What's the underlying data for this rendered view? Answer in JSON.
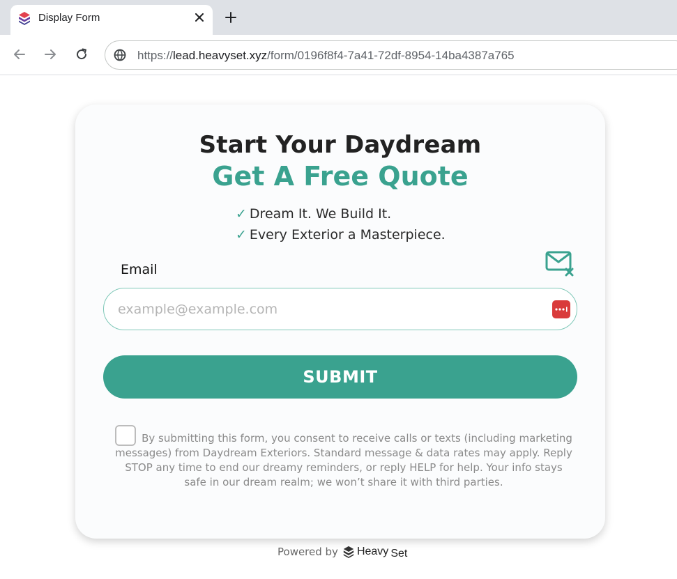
{
  "browser": {
    "tab": {
      "title": "Display Form"
    },
    "address": {
      "protocol": "https://",
      "host": "lead.heavyset.xyz",
      "path": "/form/0196f8f4-7a41-72df-8954-14ba4387a765"
    }
  },
  "form": {
    "heading": "Start Your Daydream",
    "subheading": "Get A Free Quote",
    "check_glyph": "✓",
    "bullets": [
      "Dream It. We Build It.",
      "Every Exterior a Masterpiece."
    ],
    "email_label": "Email",
    "email_placeholder": "example@example.com",
    "email_value": "",
    "submit_label": "SUBMIT",
    "consent_checked": false,
    "consent_text": "By submitting this form, you consent to receive calls or texts (including marketing messages) from Daydream Exteriors. Standard message & data rates may apply. Reply STOP any time to end our dreamy reminders, or reply HELP for help. Your info stays safe in our dream realm; we won’t share it with third parties."
  },
  "footer": {
    "powered_by": "Powered by",
    "brand_part1": "Heavy",
    "brand_part2": "Set"
  },
  "colors": {
    "accent": "#3aa28f",
    "heading": "#222222",
    "password_manager": "#d93b3b"
  },
  "icons": {
    "favicon": "heavyset-logo-icon",
    "mail_status": "mail-x-icon",
    "password_manager": "password-manager-icon"
  }
}
